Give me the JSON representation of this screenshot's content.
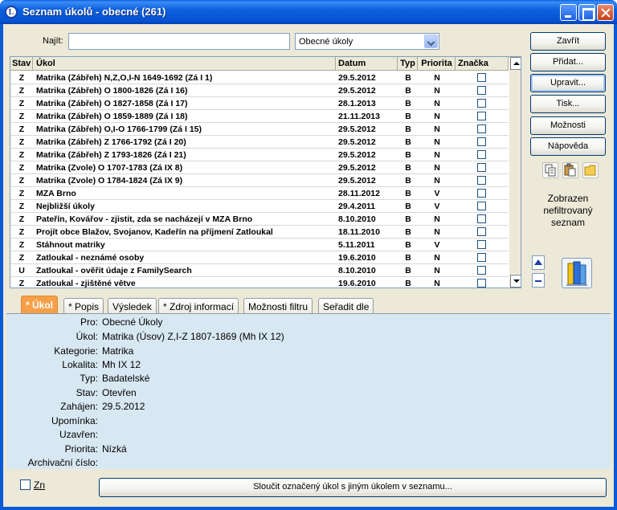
{
  "window": {
    "title": "Seznam úkolů - obecné (261)",
    "app_icon_letter": "L"
  },
  "search": {
    "label": "Najít:",
    "value": "",
    "filter_selected": "Obecné úkoly"
  },
  "table": {
    "columns": [
      "Stav",
      "Úkol",
      "Datum",
      "Typ",
      "Priorita",
      "Značka"
    ],
    "rows": [
      {
        "stav": "Z",
        "ukol": "Matrika (Zábřeh) N,Z,O,I-N 1649-1692 (Zá I 1)",
        "datum": "29.5.2012",
        "typ": "B",
        "priorita": "N",
        "znacka": false
      },
      {
        "stav": "Z",
        "ukol": "Matrika (Zábřeh) O 1800-1826 (Zá I 16)",
        "datum": "29.5.2012",
        "typ": "B",
        "priorita": "N",
        "znacka": false
      },
      {
        "stav": "Z",
        "ukol": "Matrika (Zábřeh) O 1827-1858 (Zá I 17)",
        "datum": "28.1.2013",
        "typ": "B",
        "priorita": "N",
        "znacka": false
      },
      {
        "stav": "Z",
        "ukol": "Matrika (Zábřeh) O 1859-1889 (Zá I 18)",
        "datum": "21.11.2013",
        "typ": "B",
        "priorita": "N",
        "znacka": false
      },
      {
        "stav": "Z",
        "ukol": "Matrika (Zábřeh) O,I-O 1766-1799 (Zá I 15)",
        "datum": "29.5.2012",
        "typ": "B",
        "priorita": "N",
        "znacka": false
      },
      {
        "stav": "Z",
        "ukol": "Matrika (Zábřeh) Z 1766-1792 (Zá I 20)",
        "datum": "29.5.2012",
        "typ": "B",
        "priorita": "N",
        "znacka": false
      },
      {
        "stav": "Z",
        "ukol": "Matrika (Zábřeh) Z 1793-1826 (Zá I 21)",
        "datum": "29.5.2012",
        "typ": "B",
        "priorita": "N",
        "znacka": false
      },
      {
        "stav": "Z",
        "ukol": "Matrika (Zvole) O 1707-1783 (Zá IX 8)",
        "datum": "29.5.2012",
        "typ": "B",
        "priorita": "N",
        "znacka": false
      },
      {
        "stav": "Z",
        "ukol": "Matrika (Zvole) O 1784-1824 (Zá IX 9)",
        "datum": "29.5.2012",
        "typ": "B",
        "priorita": "N",
        "znacka": false
      },
      {
        "stav": "Z",
        "ukol": "MZA Brno",
        "datum": "28.11.2012",
        "typ": "B",
        "priorita": "V",
        "znacka": false
      },
      {
        "stav": "Z",
        "ukol": "Nejbližší úkoly",
        "datum": "29.4.2011",
        "typ": "B",
        "priorita": "V",
        "znacka": false
      },
      {
        "stav": "Z",
        "ukol": "Pateřín, Kovářov - zjistit, zda se nacházejí v MZA Brno",
        "datum": "8.10.2010",
        "typ": "B",
        "priorita": "N",
        "znacka": false
      },
      {
        "stav": "Z",
        "ukol": "Projít obce Blažov, Svojanov, Kadeřín na příjmení Zatloukal",
        "datum": "18.11.2010",
        "typ": "B",
        "priorita": "N",
        "znacka": false
      },
      {
        "stav": "Z",
        "ukol": "Stáhnout matriky",
        "datum": "5.11.2011",
        "typ": "B",
        "priorita": "V",
        "znacka": false
      },
      {
        "stav": "Z",
        "ukol": "Zatloukal - neznámé osoby",
        "datum": "19.6.2010",
        "typ": "B",
        "priorita": "N",
        "znacka": false
      },
      {
        "stav": "U",
        "ukol": "Zatloukal - ověřit údaje z FamilySearch",
        "datum": "8.10.2010",
        "typ": "B",
        "priorita": "N",
        "znacka": false
      },
      {
        "stav": "Z",
        "ukol": "Zatloukal - zjištěné větve",
        "datum": "19.6.2010",
        "typ": "B",
        "priorita": "N",
        "znacka": false
      }
    ]
  },
  "buttons": {
    "close": "Zavřít",
    "add": "Přidat...",
    "edit": "Upravit...",
    "print": "Tisk...",
    "options": "Možnosti",
    "help": "Nápověda"
  },
  "filter_note": "Zobrazen nefiltrovaný seznam",
  "tabs": [
    {
      "label": "* Úkol",
      "active": true
    },
    {
      "label": "* Popis",
      "active": false
    },
    {
      "label": "Výsledek",
      "active": false
    },
    {
      "label": "* Zdroj informací",
      "active": false
    },
    {
      "label": "Možnosti filtru",
      "active": false
    },
    {
      "label": "Seřadit dle",
      "active": false
    }
  ],
  "details": [
    {
      "label": "Pro:",
      "value": "Obecné Úkoly"
    },
    {
      "label": "Úkol:",
      "value": "Matrika (Úsov) Z,I-Z 1807-1869 (Mh IX 12)"
    },
    {
      "label": "Kategorie:",
      "value": "Matrika"
    },
    {
      "label": "Lokalita:",
      "value": "Mh IX 12"
    },
    {
      "label": "Typ:",
      "value": "Badatelské"
    },
    {
      "label": "Stav:",
      "value": "Otevřen"
    },
    {
      "label": "Zahájen:",
      "value": "29.5.2012"
    },
    {
      "label": "Upomínka:",
      "value": ""
    },
    {
      "label": "Uzavřen:",
      "value": ""
    },
    {
      "label": "Priorita:",
      "value": "Nízká"
    },
    {
      "label": "Archivační číslo:",
      "value": ""
    }
  ],
  "bottom": {
    "zn_label": "Zn",
    "merge_button": "Sloučit označený úkol s jiným úkolem v seznamu..."
  }
}
